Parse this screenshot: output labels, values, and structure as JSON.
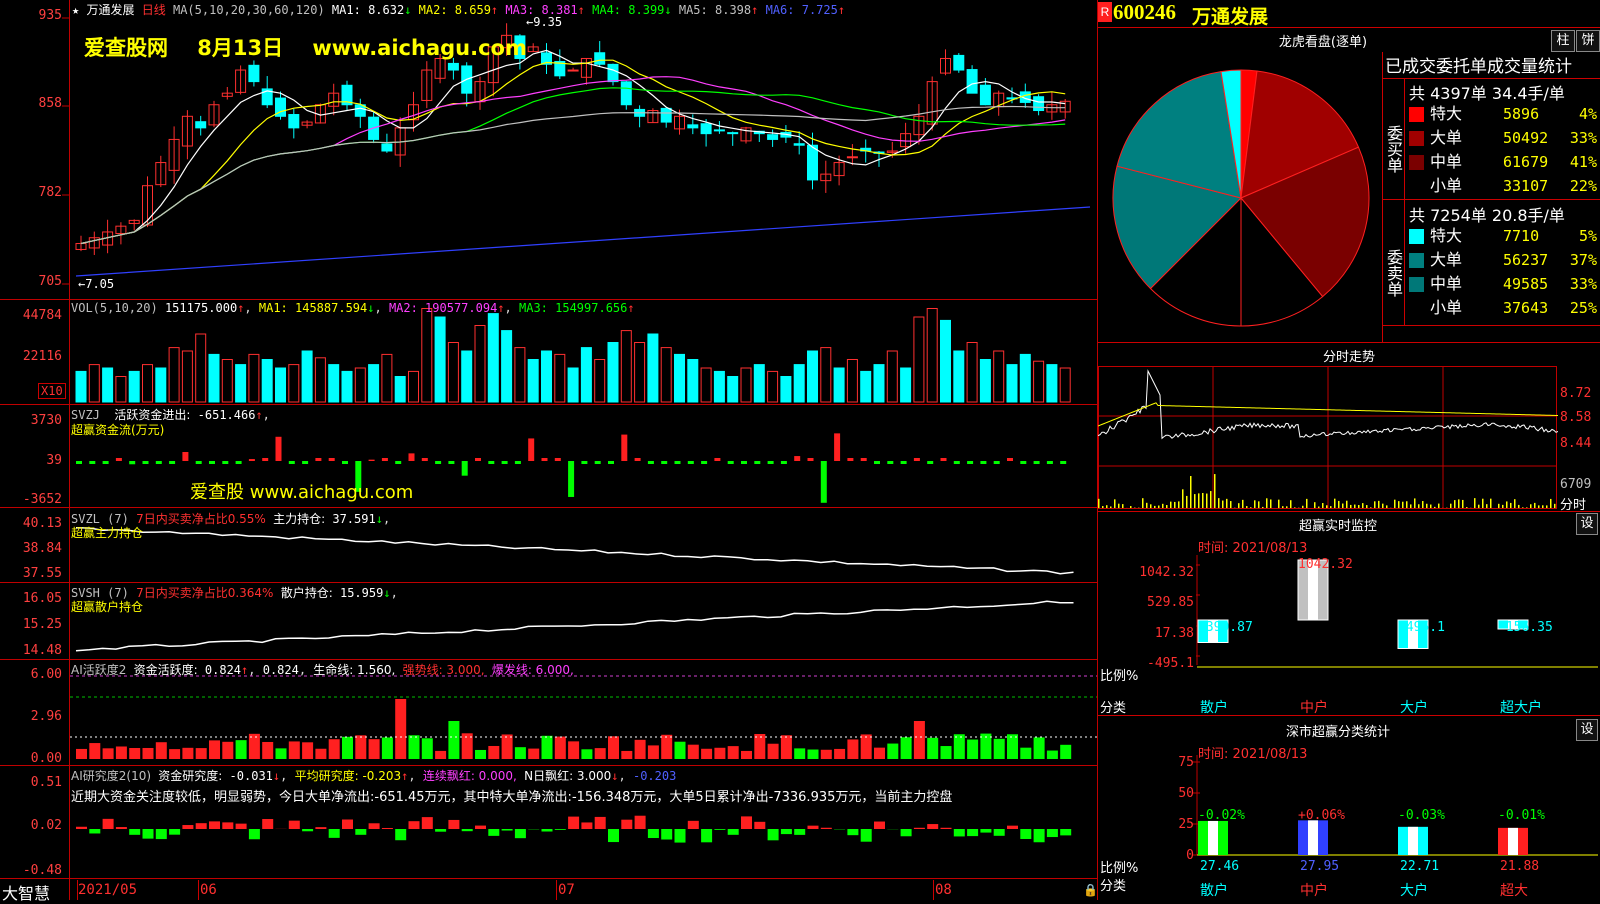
{
  "header": {
    "stock_name": "万通发展",
    "period": "日线",
    "ma_params": "MA(5,10,20,30,60,120)",
    "ma": [
      {
        "label": "MA1:",
        "value": "8.632",
        "arrow": "↓",
        "color": "#ffffff"
      },
      {
        "label": "MA2:",
        "value": "8.659",
        "arrow": "↑",
        "color": "#ffff00"
      },
      {
        "label": "MA3:",
        "value": "8.381",
        "arrow": "↑",
        "color": "#ff40ff"
      },
      {
        "label": "MA4:",
        "value": "8.399",
        "arrow": "↓",
        "color": "#00ff00"
      },
      {
        "label": "MA5:",
        "value": "8.398",
        "arrow": "↑",
        "color": "#c0c0c0"
      },
      {
        "label": "MA6:",
        "value": "7.725",
        "arrow": "↑",
        "color": "#4060ff"
      }
    ],
    "high_marker": "9.35",
    "low_marker": "7.05"
  },
  "watermark": {
    "site": "爱查股网",
    "date": "8月13日",
    "url": "www.aichagu.com"
  },
  "watermark2": "爱查股 www.aichagu.com",
  "price_axis": [
    "935",
    "858",
    "782",
    "705"
  ],
  "volume": {
    "title": "VOL(5,10,20)",
    "value": "151175.000",
    "ma1": "MA1: 145887.594",
    "ma2": "MA2: 190577.094",
    "ma3": "MA3: 154997.656",
    "axis": [
      "44784",
      "22116"
    ],
    "unit": "X10",
    "bars": [
      0.18,
      0.22,
      0.2,
      0.15,
      0.18,
      0.22,
      0.2,
      0.32,
      0.3,
      0.4,
      0.28,
      0.25,
      0.22,
      0.28,
      0.25,
      0.2,
      0.22,
      0.3,
      0.26,
      0.22,
      0.18,
      0.2,
      0.22,
      0.28,
      0.15,
      0.18,
      0.55,
      0.5,
      0.35,
      0.3,
      0.45,
      0.52,
      0.42,
      0.32,
      0.25,
      0.3,
      0.28,
      0.2,
      0.32,
      0.25,
      0.35,
      0.42,
      0.35,
      0.4,
      0.32,
      0.28,
      0.25,
      0.2,
      0.18,
      0.15,
      0.2,
      0.22,
      0.18,
      0.15,
      0.22,
      0.3,
      0.32,
      0.2,
      0.25,
      0.18,
      0.22,
      0.3,
      0.2,
      0.5,
      0.55,
      0.48,
      0.3,
      0.35,
      0.25,
      0.3,
      0.22,
      0.28,
      0.24,
      0.22,
      0.2
    ],
    "bar_colors": [
      "c",
      "r",
      "c",
      "r",
      "c",
      "r",
      "c",
      "r",
      "r",
      "r",
      "c",
      "r",
      "c",
      "r",
      "c",
      "c",
      "r",
      "c",
      "r",
      "c",
      "c",
      "r",
      "c",
      "r",
      "c",
      "r",
      "r",
      "c",
      "r",
      "c",
      "r",
      "c",
      "c",
      "r",
      "c",
      "c",
      "r",
      "c",
      "c",
      "r",
      "c",
      "r",
      "r",
      "c",
      "r",
      "c",
      "c",
      "r",
      "c",
      "c",
      "r",
      "c",
      "r",
      "c",
      "c",
      "c",
      "r",
      "c",
      "r",
      "c",
      "c",
      "r",
      "c",
      "r",
      "r",
      "c",
      "c",
      "r",
      "c",
      "r",
      "c",
      "c",
      "r",
      "c",
      "r"
    ]
  },
  "svzj": {
    "title": "SVZJ",
    "label": "活跃资金进出:",
    "value": "-651.466",
    "sub": "超赢资金流(万元)",
    "axis": [
      "3730",
      "39",
      "-3652"
    ]
  },
  "svzl": {
    "title": "SVZL",
    "param": "(7)",
    "desc": "7日内买卖净占比0.55%",
    "label": "主力持仓:",
    "value": "37.591",
    "sub": "超赢主力持仓",
    "axis": [
      "40.13",
      "38.84",
      "37.55"
    ]
  },
  "svsh": {
    "title": "SVSH",
    "param": "(7)",
    "desc": "7日内买卖净占比0.364%",
    "label": "散户持仓:",
    "value": "15.959",
    "sub": "超赢散户持仓",
    "axis": [
      "16.05",
      "15.25",
      "14.48"
    ]
  },
  "ai_active": {
    "title": "AI活跃度2",
    "label": "资金活跃度:",
    "value": "0.824",
    "value2": "0.824",
    "life": "生命线: 1.560,",
    "strong": "强势线: 3.000,",
    "burst": "爆发线: 6.000,",
    "axis": [
      "6.00",
      "2.96",
      "0.00"
    ]
  },
  "ai_research": {
    "title": "AI研究度2(10)",
    "label": "资金研究度:",
    "value": "-0.031",
    "avg": "平均研究度: -0.203",
    "consec": "连续飘红: 0.000,",
    "nred": "N日飘红: 3.000",
    "last": "-0.203",
    "comment": "近期大资金关注度较低，明显弱势，今日大单净流出:-651.45万元，其中特大单净流出:-156.348万元，大单5日累计净出-7336.935万元，当前主力控盘",
    "axis": [
      "0.51",
      "0.02",
      "-0.48"
    ]
  },
  "date_axis": [
    "2021/05",
    "06",
    "07",
    "08"
  ],
  "logo": "大智慧",
  "side": {
    "r_badge": "R",
    "code": "600246",
    "name": "万通发展",
    "longhu_title": "龙虎看盘(逐单)",
    "btn_bar": "柱",
    "btn_pie": "饼",
    "order_header": "已成交委托单成交量统计",
    "buy_label": "委买单",
    "sell_label": "委卖单",
    "buy_total": "共 4397单 34.4手/单",
    "sell_total": "共 7254单 20.8手/单",
    "buy_rows": [
      {
        "name": "特大",
        "value": "5896",
        "pct": "4%",
        "color": "#ff0000"
      },
      {
        "name": "大单",
        "value": "50492",
        "pct": "33%",
        "color": "#a00000"
      },
      {
        "name": "中单",
        "value": "61679",
        "pct": "41%",
        "color": "#7a0000"
      },
      {
        "name": "小单",
        "value": "33107",
        "pct": "22%",
        "color": "#000000"
      }
    ],
    "sell_rows": [
      {
        "name": "特大",
        "value": "7710",
        "pct": "5%",
        "color": "#00ffff"
      },
      {
        "name": "大单",
        "value": "56237",
        "pct": "37%",
        "color": "#008080"
      },
      {
        "name": "中单",
        "value": "49585",
        "pct": "33%",
        "color": "#007878"
      },
      {
        "name": "小单",
        "value": "37643",
        "pct": "25%",
        "color": "#000000"
      }
    ],
    "intraday_title": "分时走势",
    "intraday_axis": [
      "8.72",
      "8.58",
      "8.44"
    ],
    "intraday_vol": "6709",
    "intraday_label": "分时",
    "monitor_title": "超赢实时监控",
    "monitor_btn": "设",
    "monitor_time": "时间: 2021/08/13",
    "monitor_axis": [
      "1042.32",
      "529.85",
      "17.38",
      "-495.1"
    ],
    "monitor_values": [
      "-390.87",
      "1042.32",
      "-495.1",
      "-156.35"
    ],
    "monitor_ratio": "比例%",
    "monitor_cat": "分类",
    "categories": [
      "散户",
      "中户",
      "大户",
      "超大户"
    ],
    "stat_title": "深市超赢分类统计",
    "stat_btn": "设",
    "stat_time": "时间: 2021/08/13",
    "stat_axis": [
      "75",
      "50",
      "25",
      "0"
    ],
    "stat_changes": [
      "-0.02%",
      "+0.06%",
      "-0.03%",
      "-0.01%"
    ],
    "stat_values": [
      "27.46",
      "27.95",
      "22.71",
      "21.88"
    ],
    "stat_ratio": "比例%",
    "stat_cat": "分类",
    "stat_categories": [
      "散户",
      "中户",
      "大户",
      "超大"
    ]
  }
}
